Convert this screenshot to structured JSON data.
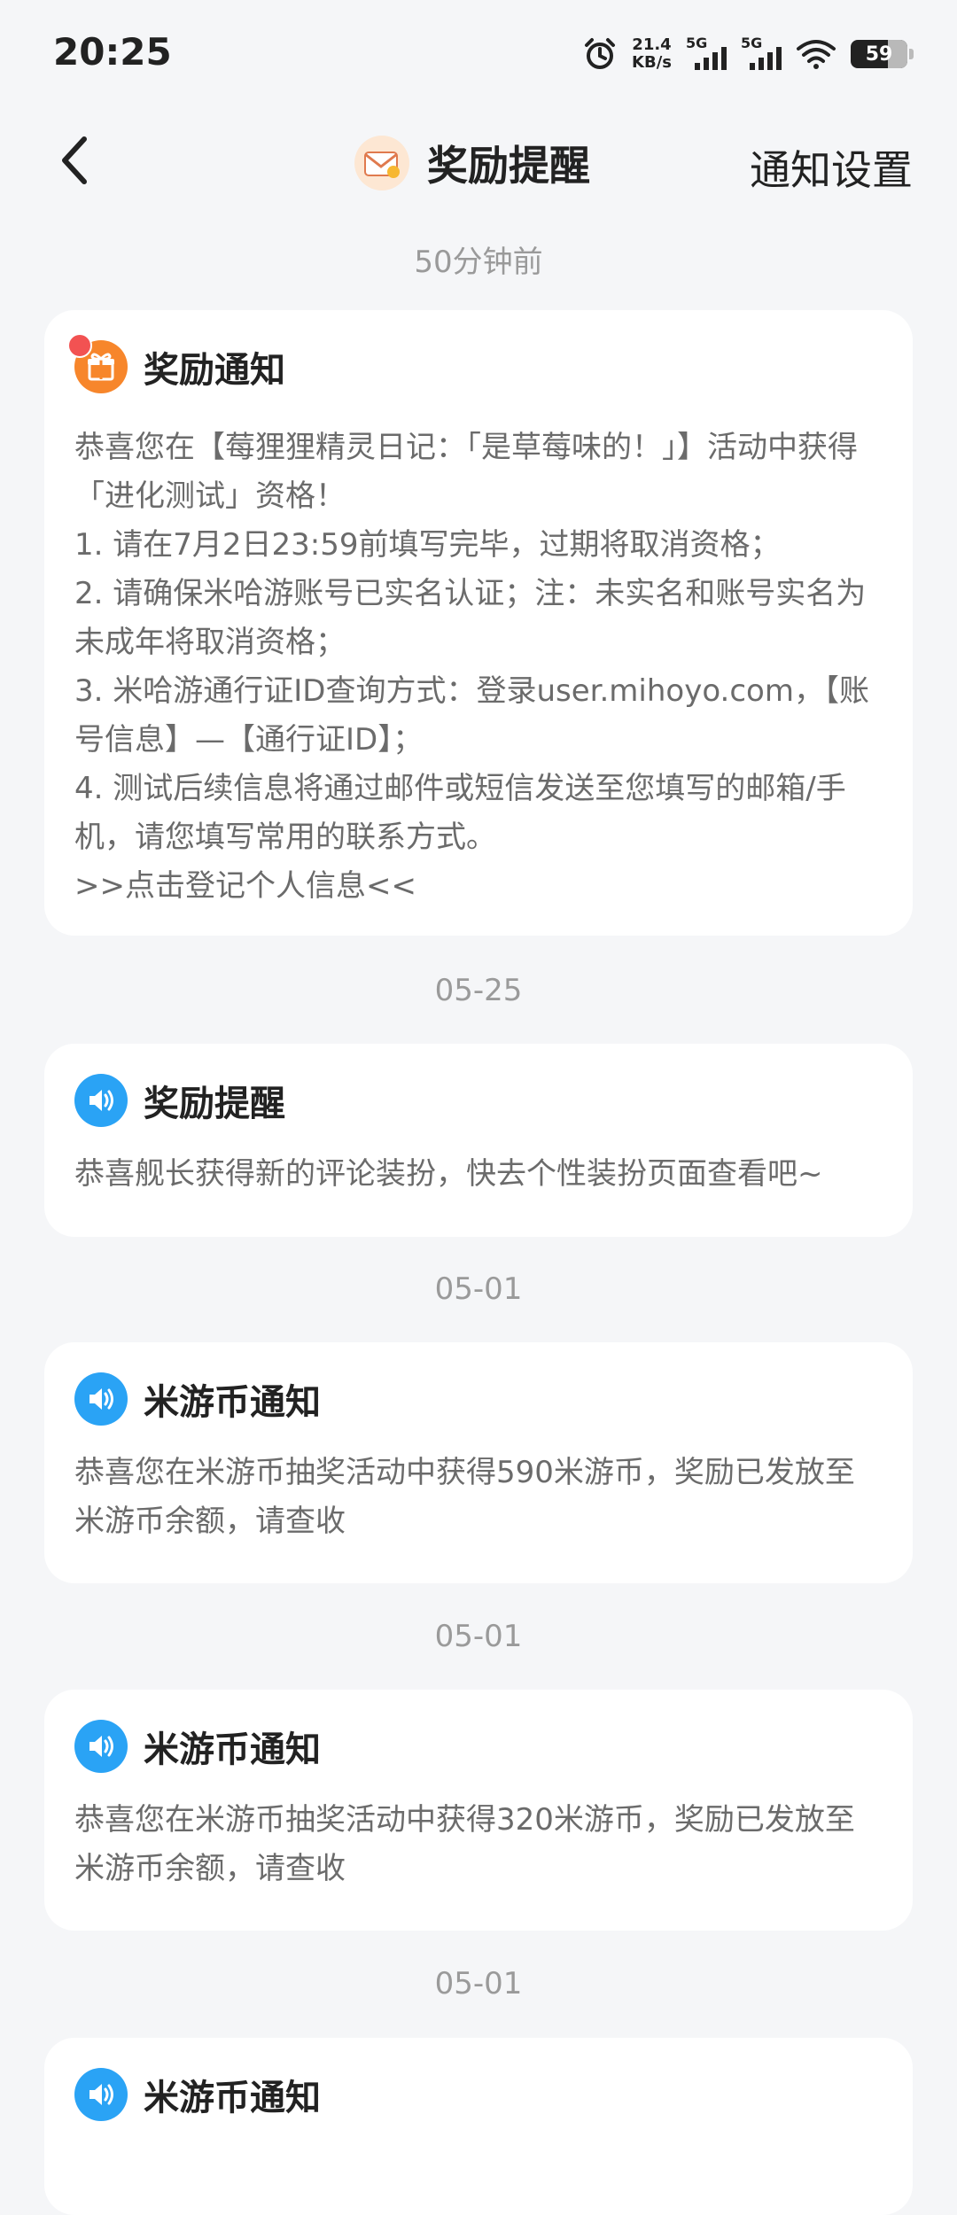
{
  "status": {
    "time": "20:25",
    "net_speed_value": "21.4",
    "net_speed_unit": "KB/s",
    "sig1_label": "5G",
    "sig2_label": "5G",
    "battery": "59"
  },
  "header": {
    "title": "奖励提醒",
    "settings_label": "通知设置"
  },
  "timeline": [
    {
      "time": "50分钟前",
      "title": "奖励通知",
      "icon": "gift-icon",
      "unread": true,
      "lines": [
        "恭喜您在【莓狸狸精灵日记：「是草莓味的！」】活动中获得「进化测试」资格！",
        "1. 请在7月2日23:59前填写完毕，过期将取消资格；",
        "2. 请确保米哈游账号已实名认证；注：未实名和账号实名为未成年将取消资格；",
        "3. 米哈游通行证ID查询方式：登录user.mihoyo.com，【账号信息】—【通行证ID】；",
        "4. 测试后续信息将通过邮件或短信发送至您填写的邮箱/手机，请您填写常用的联系方式。"
      ],
      "link": ">>点击登记个人信息<<"
    },
    {
      "time": "05-25",
      "title": "奖励提醒",
      "icon": "speaker-icon",
      "lines": [
        "恭喜舰长获得新的评论装扮，快去个性装扮页面查看吧~"
      ]
    },
    {
      "time": "05-01",
      "title": "米游币通知",
      "icon": "speaker-icon",
      "lines": [
        "恭喜您在米游币抽奖活动中获得590米游币，奖励已发放至米游币余额，请查收"
      ]
    },
    {
      "time": "05-01",
      "title": "米游币通知",
      "icon": "speaker-icon",
      "lines": [
        "恭喜您在米游币抽奖活动中获得320米游币，奖励已发放至米游币余额，请查收"
      ]
    },
    {
      "time": "05-01",
      "title": "米游币通知",
      "icon": "speaker-icon",
      "lines": []
    }
  ],
  "colors": {
    "background": "#f5f6f8",
    "gift_icon": "#f7862b",
    "speaker_icon": "#2aa3f5",
    "unread_dot": "#f25252"
  }
}
